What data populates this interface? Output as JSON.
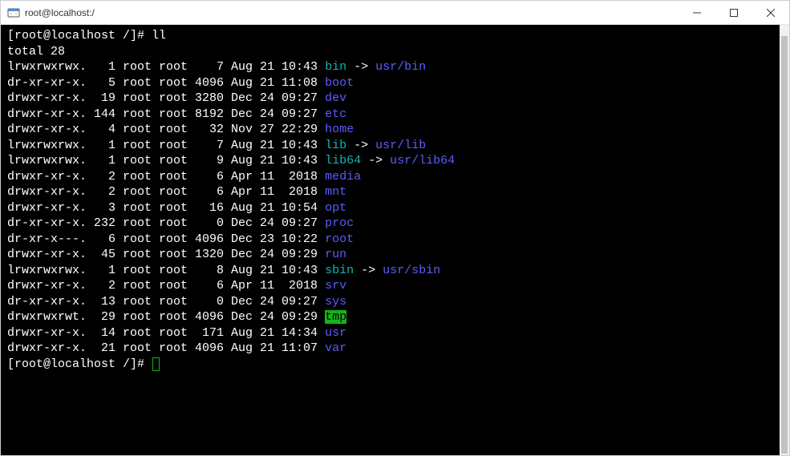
{
  "window": {
    "title": "root@localhost:/"
  },
  "terminal": {
    "prompt_prefix": "[root@localhost /]# ",
    "command": "ll",
    "total_line": "total 28",
    "listing": [
      {
        "perms": "lrwxrwxrwx.",
        "links": "1",
        "owner": "root",
        "group": "root",
        "size": "7",
        "month": "Aug",
        "day": "21",
        "time": "10:43",
        "name": "bin",
        "link_target": "usr/bin",
        "name_color": "cyan",
        "target_color": "blue"
      },
      {
        "perms": "dr-xr-xr-x.",
        "links": "5",
        "owner": "root",
        "group": "root",
        "size": "4096",
        "month": "Aug",
        "day": "21",
        "time": "11:08",
        "name": "boot",
        "name_color": "blue"
      },
      {
        "perms": "drwxr-xr-x.",
        "links": "19",
        "owner": "root",
        "group": "root",
        "size": "3280",
        "month": "Dec",
        "day": "24",
        "time": "09:27",
        "name": "dev",
        "name_color": "blue"
      },
      {
        "perms": "drwxr-xr-x.",
        "links": "144",
        "owner": "root",
        "group": "root",
        "size": "8192",
        "month": "Dec",
        "day": "24",
        "time": "09:27",
        "name": "etc",
        "name_color": "blue"
      },
      {
        "perms": "drwxr-xr-x.",
        "links": "4",
        "owner": "root",
        "group": "root",
        "size": "32",
        "month": "Nov",
        "day": "27",
        "time": "22:29",
        "name": "home",
        "name_color": "blue"
      },
      {
        "perms": "lrwxrwxrwx.",
        "links": "1",
        "owner": "root",
        "group": "root",
        "size": "7",
        "month": "Aug",
        "day": "21",
        "time": "10:43",
        "name": "lib",
        "link_target": "usr/lib",
        "name_color": "cyan",
        "target_color": "blue"
      },
      {
        "perms": "lrwxrwxrwx.",
        "links": "1",
        "owner": "root",
        "group": "root",
        "size": "9",
        "month": "Aug",
        "day": "21",
        "time": "10:43",
        "name": "lib64",
        "link_target": "usr/lib64",
        "name_color": "cyan",
        "target_color": "blue"
      },
      {
        "perms": "drwxr-xr-x.",
        "links": "2",
        "owner": "root",
        "group": "root",
        "size": "6",
        "month": "Apr",
        "day": "11",
        "time": " 2018",
        "name": "media",
        "name_color": "blue"
      },
      {
        "perms": "drwxr-xr-x.",
        "links": "2",
        "owner": "root",
        "group": "root",
        "size": "6",
        "month": "Apr",
        "day": "11",
        "time": " 2018",
        "name": "mnt",
        "name_color": "blue"
      },
      {
        "perms": "drwxr-xr-x.",
        "links": "3",
        "owner": "root",
        "group": "root",
        "size": "16",
        "month": "Aug",
        "day": "21",
        "time": "10:54",
        "name": "opt",
        "name_color": "blue"
      },
      {
        "perms": "dr-xr-xr-x.",
        "links": "232",
        "owner": "root",
        "group": "root",
        "size": "0",
        "month": "Dec",
        "day": "24",
        "time": "09:27",
        "name": "proc",
        "name_color": "blue"
      },
      {
        "perms": "dr-xr-x---.",
        "links": "6",
        "owner": "root",
        "group": "root",
        "size": "4096",
        "month": "Dec",
        "day": "23",
        "time": "10:22",
        "name": "root",
        "name_color": "blue"
      },
      {
        "perms": "drwxr-xr-x.",
        "links": "45",
        "owner": "root",
        "group": "root",
        "size": "1320",
        "month": "Dec",
        "day": "24",
        "time": "09:29",
        "name": "run",
        "name_color": "blue"
      },
      {
        "perms": "lrwxrwxrwx.",
        "links": "1",
        "owner": "root",
        "group": "root",
        "size": "8",
        "month": "Aug",
        "day": "21",
        "time": "10:43",
        "name": "sbin",
        "link_target": "usr/sbin",
        "name_color": "cyan",
        "target_color": "blue"
      },
      {
        "perms": "drwxr-xr-x.",
        "links": "2",
        "owner": "root",
        "group": "root",
        "size": "6",
        "month": "Apr",
        "day": "11",
        "time": " 2018",
        "name": "srv",
        "name_color": "blue"
      },
      {
        "perms": "dr-xr-xr-x.",
        "links": "13",
        "owner": "root",
        "group": "root",
        "size": "0",
        "month": "Dec",
        "day": "24",
        "time": "09:27",
        "name": "sys",
        "name_color": "blue"
      },
      {
        "perms": "drwxrwxrwt.",
        "links": "29",
        "owner": "root",
        "group": "root",
        "size": "4096",
        "month": "Dec",
        "day": "24",
        "time": "09:29",
        "name": "tmp",
        "name_color": "green-bg"
      },
      {
        "perms": "drwxr-xr-x.",
        "links": "14",
        "owner": "root",
        "group": "root",
        "size": "171",
        "month": "Aug",
        "day": "21",
        "time": "14:34",
        "name": "usr",
        "name_color": "blue"
      },
      {
        "perms": "drwxr-xr-x.",
        "links": "21",
        "owner": "root",
        "group": "root",
        "size": "4096",
        "month": "Aug",
        "day": "21",
        "time": "11:07",
        "name": "var",
        "name_color": "blue"
      }
    ],
    "prompt_suffix": "[root@localhost /]# "
  }
}
